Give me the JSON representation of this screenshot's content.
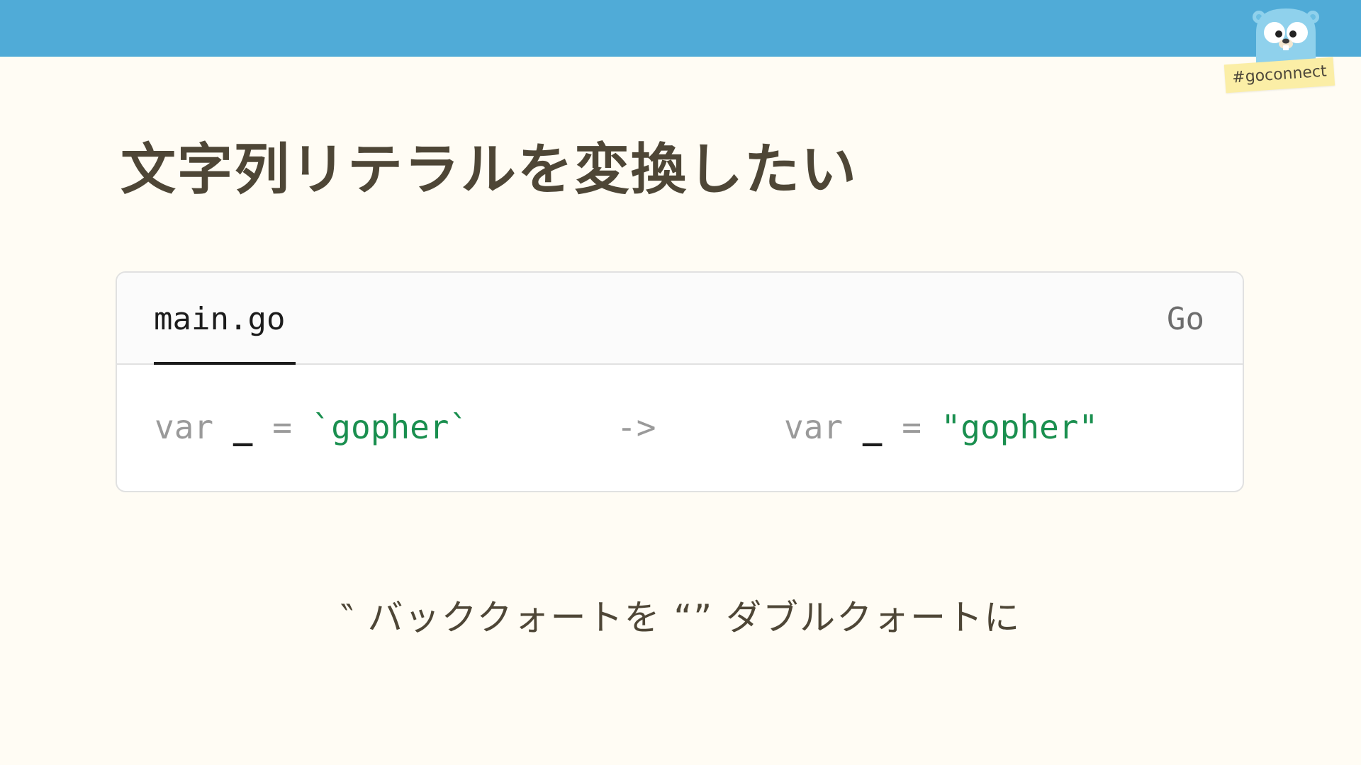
{
  "slide": {
    "title": "文字列リテラルを変換したい",
    "caption": "‶ バッククォートを “” ダブルクォートに"
  },
  "badge": {
    "hashtag": "#goconnect",
    "icon": "gopher-mascot-icon"
  },
  "code_block": {
    "filename": "main.go",
    "language": "Go",
    "before": {
      "keyword": "var",
      "identifier": "_",
      "operator": "=",
      "string": "`gopher`"
    },
    "arrow": "->",
    "after": {
      "keyword": "var",
      "identifier": "_",
      "operator": "=",
      "string": "\"gopher\""
    }
  },
  "colors": {
    "header_bar": "#50abd7",
    "background": "#fffcf4",
    "title_text": "#4e4636",
    "string_literal": "#1a8f4f",
    "keyword": "#9a9a9a",
    "hashtag_note": "#fbeea6"
  }
}
